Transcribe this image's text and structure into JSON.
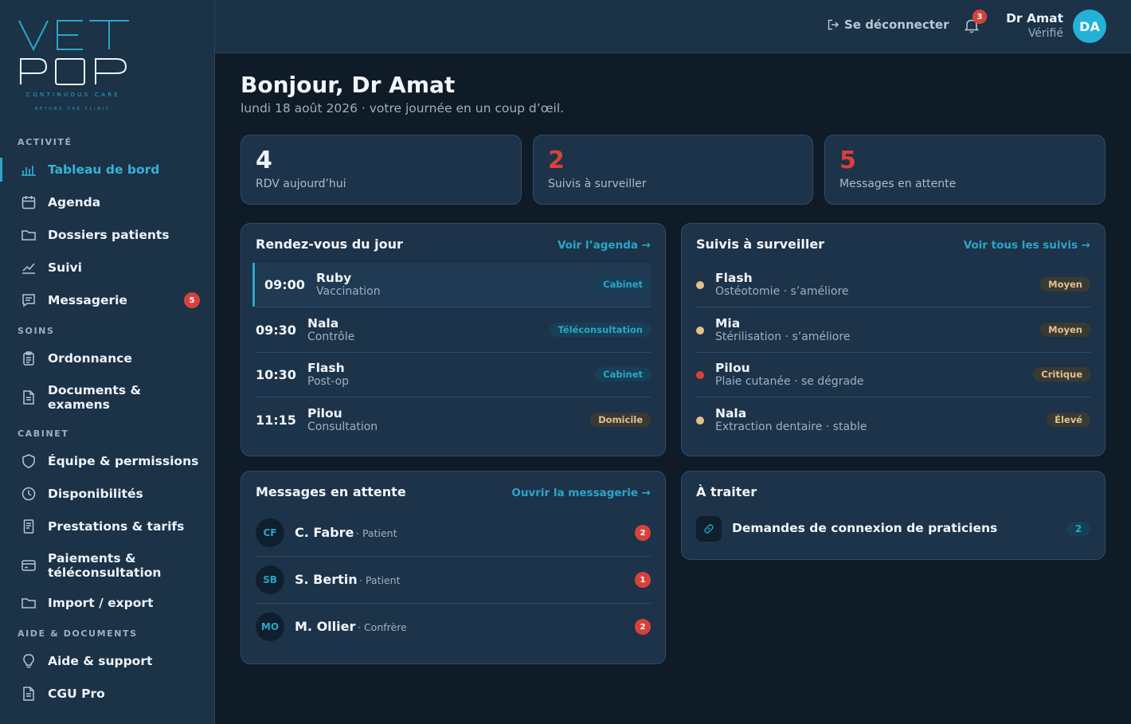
{
  "brand": {
    "logo_line1": "VET",
    "logo_line2": "POP",
    "tagline": "CONTINUOUS CARE",
    "tagline2": "BEYOND THE CLINIC"
  },
  "sidebar": {
    "sections": [
      "ACTIVITÉ",
      "SOINS",
      "CABINET",
      "AIDE & DOCUMENTS"
    ],
    "items": [
      {
        "label": "Tableau de bord",
        "icon": "chart-bars-icon",
        "active": true
      },
      {
        "label": "Agenda",
        "icon": "calendar-icon"
      },
      {
        "label": "Dossiers patients",
        "icon": "folder-icon"
      },
      {
        "label": "Suivi",
        "icon": "trend-line-icon"
      },
      {
        "label": "Messagerie",
        "icon": "message-icon",
        "badge": "5"
      },
      {
        "label": "Ordonnance",
        "icon": "clipboard-icon"
      },
      {
        "label": "Documents & examens",
        "icon": "document-icon"
      },
      {
        "label": "Équipe & permissions",
        "icon": "shield-icon"
      },
      {
        "label": "Disponibilités",
        "icon": "clock-icon"
      },
      {
        "label": "Prestations & tarifs",
        "icon": "receipt-icon"
      },
      {
        "label": "Paiements & téléconsultation",
        "icon": "credit-card-icon"
      },
      {
        "label": "Import / export",
        "icon": "folder-icon"
      },
      {
        "label": "Aide & support",
        "icon": "lightbulb-icon"
      },
      {
        "label": "CGU Pro",
        "icon": "document-icon"
      }
    ]
  },
  "header": {
    "logout": "Se déconnecter",
    "notifications": "3",
    "user_name": "Dr Amat",
    "user_status": "Vérifié",
    "avatar_initials": "DA"
  },
  "main": {
    "greeting": "Bonjour, Dr Amat",
    "subtitle": "lundi 18 août 2026 · votre journée en un coup d’œil.",
    "stats": [
      {
        "value": "4",
        "label": "RDV aujourd’hui"
      },
      {
        "value": "2",
        "label": "Suivis à surveiller"
      },
      {
        "value": "5",
        "label": "Messages en attente"
      }
    ]
  },
  "appointments": {
    "title": "Rendez-vous du jour",
    "link": "Voir l’agenda →",
    "rows": [
      {
        "time": "09:00",
        "name": "Ruby",
        "reason": "Vaccination",
        "type": "Cabinet"
      },
      {
        "time": "09:30",
        "name": "Nala",
        "reason": "Contrôle",
        "type": "Téléconsultation"
      },
      {
        "time": "10:30",
        "name": "Flash",
        "reason": "Post-op",
        "type": "Cabinet"
      },
      {
        "time": "11:15",
        "name": "Pilou",
        "reason": "Consultation",
        "type": "Domicile"
      }
    ]
  },
  "followups": {
    "title": "Suivis à surveiller",
    "link": "Voir tous les suivis →",
    "rows": [
      {
        "name": "Flash",
        "detail": "Ostéotomie · s’améliore",
        "level": "Moyen",
        "color": "#e3c08c"
      },
      {
        "name": "Mia",
        "detail": "Stérilisation · s’améliore",
        "level": "Moyen",
        "color": "#e3c08c"
      },
      {
        "name": "Pilou",
        "detail": "Plaie cutanée · se dégrade",
        "level": "Critique",
        "color": "#d8413a"
      },
      {
        "name": "Nala",
        "detail": "Extraction dentaire · stable",
        "level": "Élevé",
        "color": "#e3c08c"
      }
    ]
  },
  "messages": {
    "title": "Messages en attente",
    "link": "Ouvrir la messagerie →",
    "rows": [
      {
        "initials": "CF",
        "name": "C. Fabre",
        "role": "· Patient",
        "count": "2"
      },
      {
        "initials": "SB",
        "name": "S. Bertin",
        "role": "· Patient",
        "count": "1"
      },
      {
        "initials": "MO",
        "name": "M. Ollier",
        "role": "· Confrère",
        "count": "2"
      }
    ]
  },
  "todo": {
    "title": "À traiter",
    "items": [
      {
        "label": "Demandes de connexion de praticiens",
        "count": "2",
        "icon": "link-icon"
      }
    ]
  },
  "colors": {
    "accent": "#2aa6c8",
    "danger": "#d8413a",
    "warning": "#e3c08c",
    "sidebar_bg": "#1b3247",
    "page_bg": "#0f1b27"
  }
}
